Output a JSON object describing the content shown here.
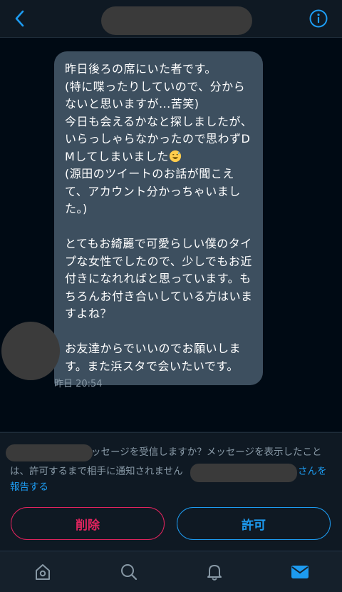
{
  "header": {
    "back_icon": "chevron-left-icon",
    "info_icon": "info-icon",
    "accent_color": "#1d9bf0"
  },
  "message": {
    "text": "昨日後ろの席にいた者です。\n(特に喋ったりしていので、分からないと思いますが...苦笑)\n今日も会えるかなと探しましたが、いらっしゃらなかったので思わずDMしてしまいました",
    "text_after_emoji": "\n(源田のツイートのお話が聞こえて、アカウント分かっちゃいました。)\n\nとてもお綺麗で可愛らしい僕のタイプな女性でしたので、少しでもお近付きになれればと思っています。もちろんお付き合いしている方はいますよね？\n\nお友達からでいいのでお願いします。また浜スタで会いたいです。",
    "emoji": "sweat-smile-emoji",
    "timestamp": "昨日 20:54"
  },
  "request_notice": {
    "line1": "ッセージを受信しますか？メッセージを表示したこと",
    "line2_before": "は、許可するまで相手に通知されません",
    "line2_link": "さんを",
    "line3_link": "報告する"
  },
  "actions": {
    "delete_label": "削除",
    "allow_label": "許可",
    "delete_color": "#e0245e",
    "allow_color": "#1d9bf0"
  },
  "tabbar": {
    "items": [
      "home-icon",
      "search-icon",
      "notifications-icon",
      "messages-icon"
    ]
  }
}
